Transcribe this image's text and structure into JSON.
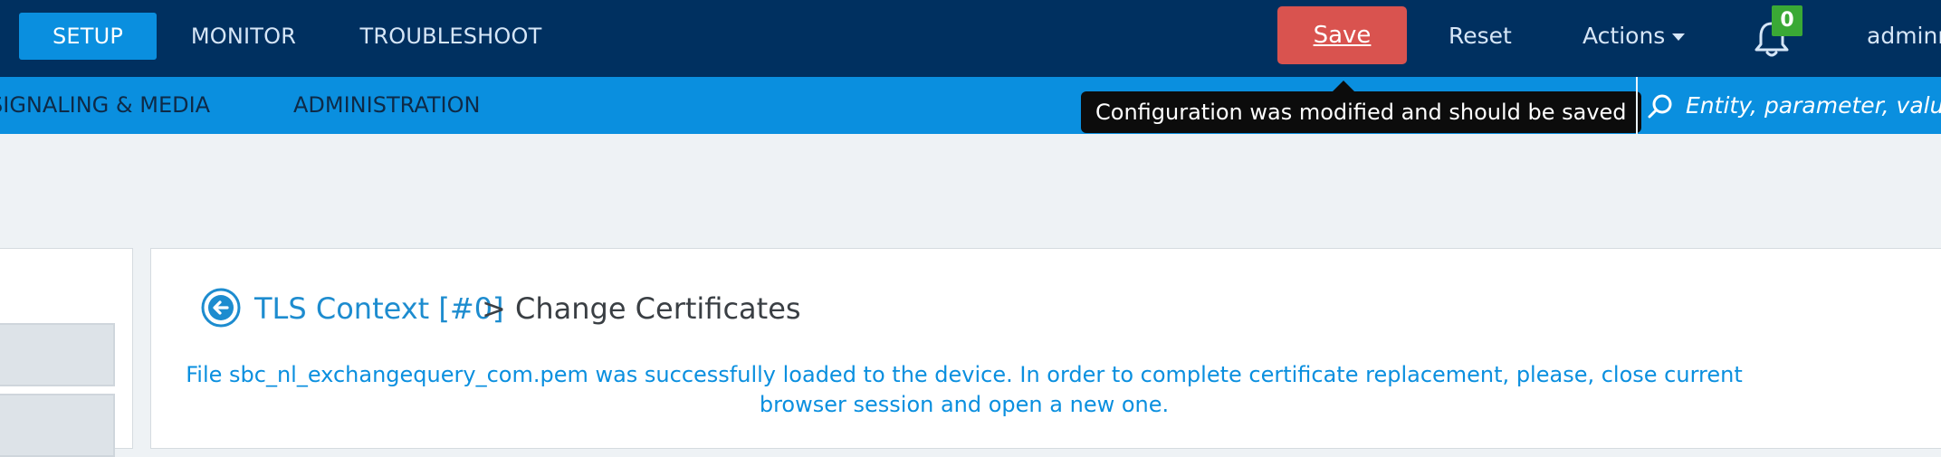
{
  "top_nav": {
    "tabs": [
      {
        "label": "SETUP",
        "active": true
      },
      {
        "label": "MONITOR",
        "active": false
      },
      {
        "label": "TROUBLESHOOT",
        "active": false
      }
    ],
    "save_label": "Save",
    "reset_label": "Reset",
    "actions_label": "Actions",
    "notification_count": "0",
    "user_label": "adminn"
  },
  "sub_nav": {
    "tabs": [
      {
        "label": "SIGNALING & MEDIA"
      },
      {
        "label": "ADMINISTRATION"
      }
    ]
  },
  "tooltip": "Configuration was modified and should be saved",
  "search": {
    "placeholder": "Entity, parameter, value"
  },
  "breadcrumb": {
    "parent": "TLS Context [#0]",
    "current": "> Change Certificates"
  },
  "message": "File  sbc_nl_exchangequery_com.pem  was successfully loaded to the device. In order to complete certificate replacement, please, close current browser session and open a new one.",
  "colors": {
    "top_bar": "#003060",
    "sub_bar": "#0a8fdf",
    "save_button": "#d9534f",
    "badge": "#3aa935",
    "link": "#1d8ccf"
  },
  "icons": {
    "notifications": "bell-icon",
    "search": "search-icon",
    "back": "back-arrow-icon",
    "actions_dropdown": "caret-down-icon"
  }
}
